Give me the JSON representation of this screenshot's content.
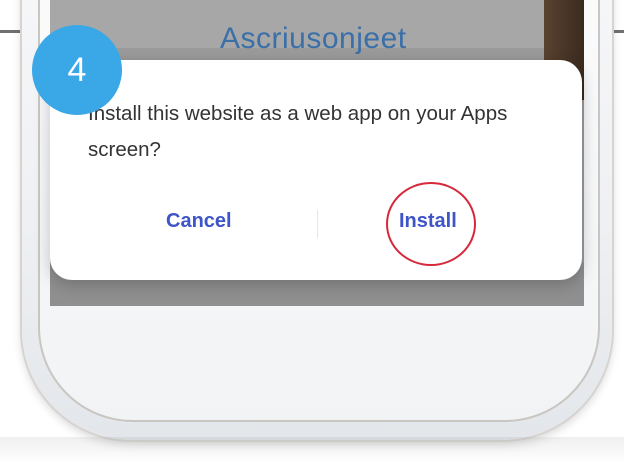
{
  "tutorial": {
    "step_number": "4"
  },
  "screen": {
    "title_text": "Ascriusonjeet"
  },
  "dialog": {
    "message": "Install this website as a web app on your Apps screen?",
    "cancel_label": "Cancel",
    "install_label": "Install"
  },
  "colors": {
    "badge": "#3aa7e6",
    "button_text": "#3e54c9",
    "highlight": "#d6293b",
    "dialog_bg": "#ffffff"
  }
}
